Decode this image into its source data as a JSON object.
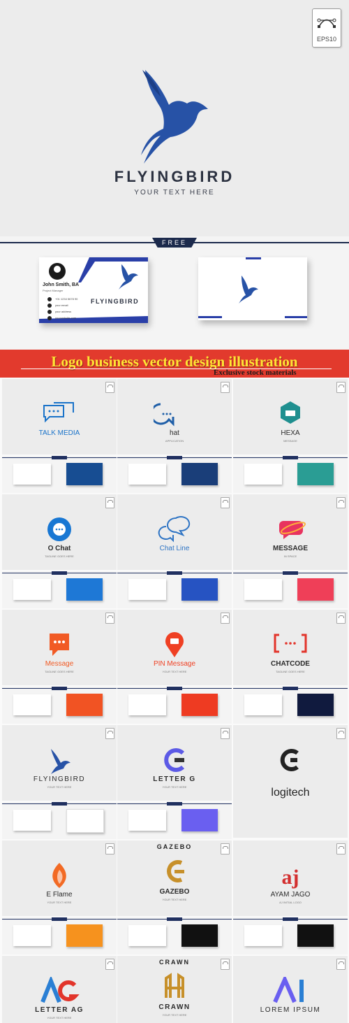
{
  "hero": {
    "badge": "EPS10",
    "brand": "FLYINGBIRD",
    "tagline": "YOUR TEXT HERE",
    "accent": "#2752a6"
  },
  "free_band": {
    "label": "FREE",
    "card": {
      "name": "John Smith, BA",
      "role": "Project Manager",
      "contacts": [
        "+01 1234 5678 90",
        "your email",
        "your address",
        "yourwebsite.com"
      ],
      "brand": "FLYINGBIRD"
    }
  },
  "banner": {
    "title": "Logo business vector design illustration",
    "subtitle": "Exclusive stock materials"
  },
  "logos": [
    {
      "name": "TALK MEDIA",
      "tagline": "",
      "color": "#1a73c9",
      "card_color": "#174d92"
    },
    {
      "name": "hat",
      "tagline": "APPLICATION",
      "color": "#1f5fa8",
      "card_color": "#1a3e79"
    },
    {
      "name": "HEXA",
      "tagline": "MESSAGE",
      "color": "#1f8f8f",
      "card_color": "#2a9d94"
    },
    {
      "name": "O Chat",
      "tagline": "TAGLINE GOES HERE",
      "color": "#1877d3",
      "card_color": "#1e78d6"
    },
    {
      "name": "Chat Line",
      "tagline": "",
      "color": "#2e74c4",
      "card_color": "#2653c2"
    },
    {
      "name": "MESSAGE",
      "tagline": "IN SPACE",
      "color": "#e8335f",
      "card_color": "#ef3f58"
    },
    {
      "name": "Message",
      "tagline": "TAGLINE GOES HERE",
      "color": "#f15a24",
      "card_color": "#f15323"
    },
    {
      "name": "PIN Message",
      "tagline": "YOUR TEXT HERE",
      "color": "#ef4023",
      "card_color": "#ee3b22"
    },
    {
      "name": "CHATCODE",
      "tagline": "TAGLINE GOES HERE",
      "color": "#e2352b",
      "card_color": "#101a3e"
    },
    {
      "name": "FLYINGBIRD",
      "tagline": "YOUR TEXT HERE",
      "color": "#2752a6",
      "card_color": "#ffffff"
    },
    {
      "name": "LETTER  G",
      "tagline": "YOUR TEXT HERE",
      "color": "#5c5ae6",
      "card_color": "#6a5ff0"
    },
    {
      "name": "logitech",
      "tagline": "",
      "color": "#222222",
      "card_color": ""
    },
    {
      "name": "E Flame",
      "tagline": "YOUR TEXT HERE",
      "color": "#f26a24",
      "card_color": "#f6921e"
    },
    {
      "name": "GAZEBO",
      "tagline": "YOUR TEXT HERE",
      "color": "#c7902a",
      "card_color": "#111111",
      "topword": "GAZEBO"
    },
    {
      "name": "AYAM JAGO",
      "tagline": "AJ INITIAL LOGO",
      "color": "#d32f2f",
      "card_color": "#111111"
    },
    {
      "name": "LETTER AG",
      "tagline": "YOUR TEXT HERE",
      "color": "#2a7fd4",
      "card_color": ""
    },
    {
      "name": "CRAWN",
      "tagline": "YOUR TEXT HERE",
      "color": "#c7902a",
      "card_color": "",
      "topword": "CRAWN"
    },
    {
      "name": "LOREM IPSUM",
      "tagline": "",
      "color": "#6a5ff0",
      "card_color": ""
    }
  ]
}
